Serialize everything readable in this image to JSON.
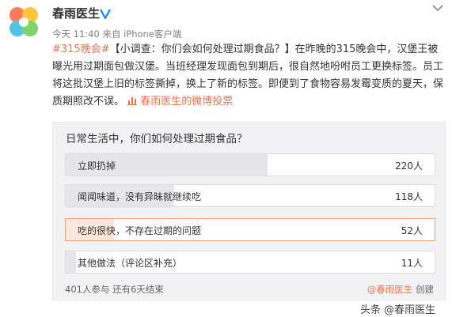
{
  "account": {
    "name": "春雨医生",
    "meta": "今天 11:40 来自 iPhone客户端",
    "verified_icon": "verified-badge-icon",
    "logo_icon": "chunyu-petal-logo"
  },
  "post": {
    "hashtag": "#315晚会#",
    "text": "【小调查：你们会如何处理过期食品？】在昨晚的315晚会中，汉堡王被曝光用过期面包做汉堡。当班经理发现面包到期后，很自然地吩咐员工更换标签。员工将这批汉堡上旧的标签撕掉，换上了新的标签。即便到了食物容易发霉变质的夏天，保质期照改不误。",
    "vote_link_icon": "vote-chart-icon",
    "vote_link": "春雨医生的微博投票"
  },
  "poll": {
    "question": "日常生活中，你们如何处理过期食品？",
    "options": [
      {
        "label": "立即扔掉",
        "count": "220人",
        "fraction": 0.548
      },
      {
        "label": "闻闻味道，没有异昧就继续吃",
        "count": "118人",
        "fraction": 0.294
      },
      {
        "label": "吃的很快，不存在过期的问题",
        "count": "52人",
        "fraction": 0.13,
        "selected": true
      },
      {
        "label": "其他做法（评论区补充）",
        "count": "11人",
        "fraction": 0.027
      }
    ],
    "participants": "401人参与",
    "remaining": "还有6天结束",
    "creator": "@春雨医生",
    "created": "创建"
  },
  "watermark": "头条 @春雨医生",
  "colors": {
    "accent": "#eb7350",
    "selected_border": "#f0a07a"
  }
}
